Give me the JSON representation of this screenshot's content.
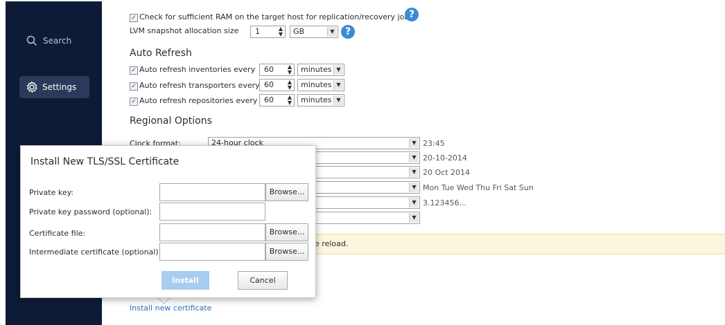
{
  "sidebar": {
    "search_label": "Search",
    "settings_label": "Settings"
  },
  "general": {
    "ram_check_label": "Check for sufficient RAM on the target host for replication/recovery jobs",
    "lvm_label": "LVM snapshot allocation size",
    "lvm_value": "1",
    "lvm_unit": "GB"
  },
  "auto_refresh": {
    "heading": "Auto Refresh",
    "rows": [
      {
        "label": "Auto refresh inventories every",
        "value": "60",
        "unit": "minutes"
      },
      {
        "label": "Auto refresh transporters every",
        "value": "60",
        "unit": "minutes"
      },
      {
        "label": "Auto refresh repositories every",
        "value": "60",
        "unit": "minutes"
      }
    ]
  },
  "regional": {
    "heading": "Regional Options",
    "clock_label": "Clock format:",
    "clock_value": "24-hour clock",
    "examples": [
      "23:45",
      "20-10-2014",
      "20 Oct 2014",
      "Mon Tue Wed Thu Fri Sat Sun",
      "3.123456...",
      ""
    ]
  },
  "notice_text": "e reload.",
  "install_link": "Install new certificate",
  "dialog": {
    "title": "Install New TLS/SSL Certificate",
    "fields": [
      {
        "label": "Private key:",
        "has_browse": true
      },
      {
        "label": "Private key password (optional):",
        "has_browse": false
      },
      {
        "label": "Certificate file:",
        "has_browse": true
      },
      {
        "label": "Intermediate certificate (optional):",
        "has_browse": true
      }
    ],
    "browse_label": "Browse...",
    "install_label": "Install",
    "cancel_label": "Cancel"
  },
  "colors": {
    "sidebar_bg": "#0d1b36",
    "accent": "#3a8bd6",
    "install_disabled": "#a9cdf0"
  }
}
